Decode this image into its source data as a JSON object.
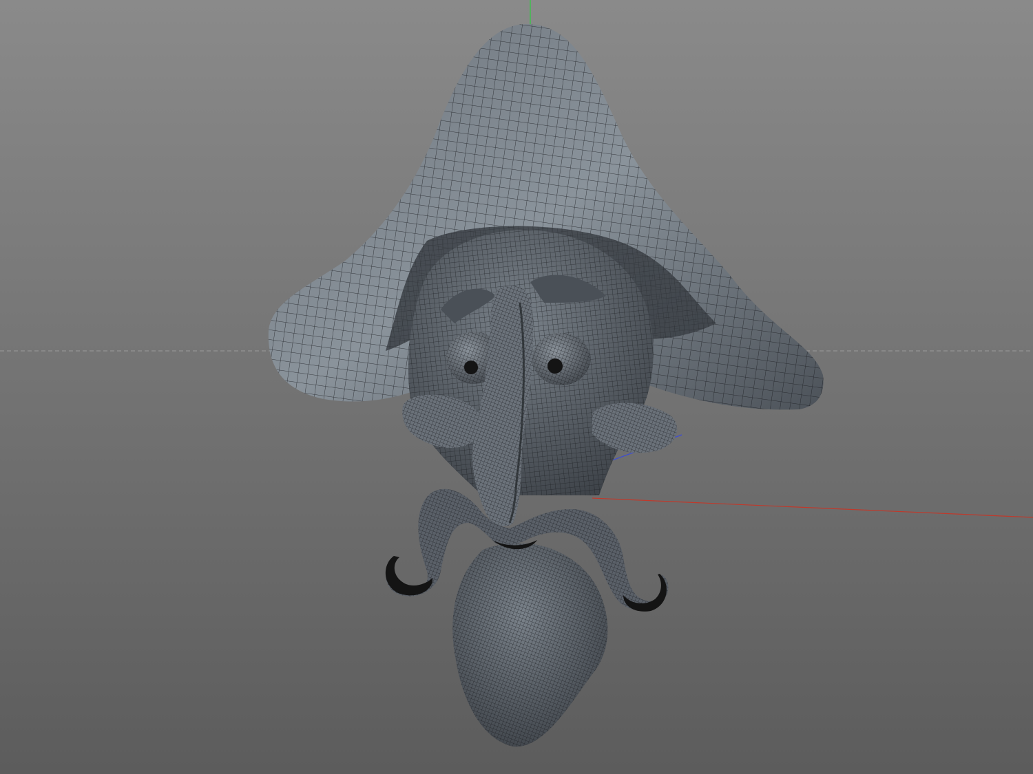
{
  "viewport": {
    "background_top": "#8a8a8a",
    "background_bottom": "#5c5c5c",
    "grid_line_color": "#9c9c9c",
    "axis_x_color": "#c0392b",
    "axis_y_color": "#2ecc40",
    "axis_z_color": "#3b4bd8"
  },
  "model": {
    "surface_color": "#5a6068",
    "highlight_color": "#9aa3ab",
    "wire_color": "#1a1c1f",
    "dark_color": "#141414",
    "eye_white": "#6b727a"
  }
}
